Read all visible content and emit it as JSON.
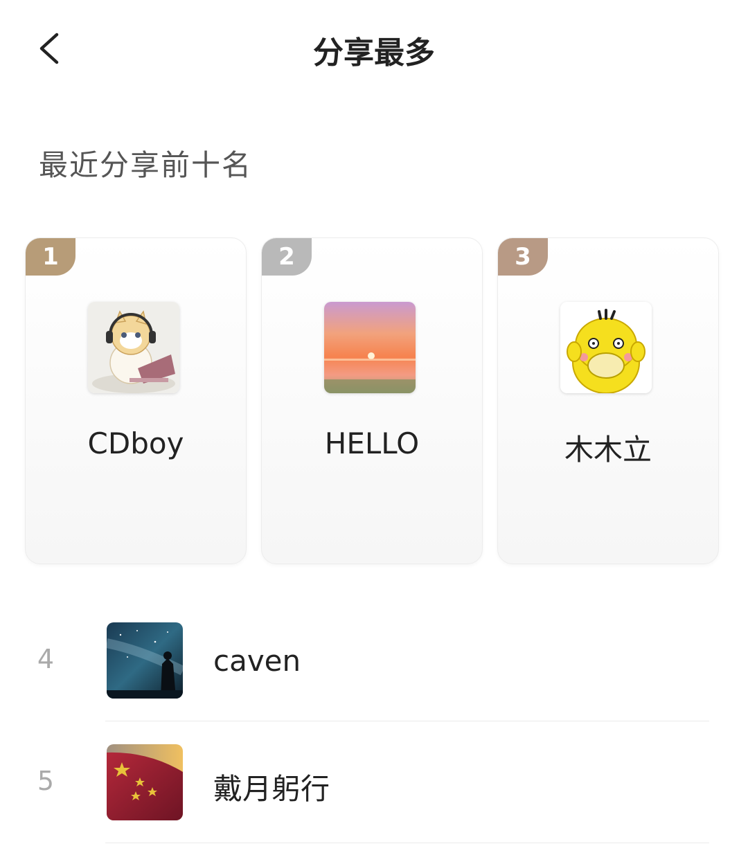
{
  "header": {
    "title": "分享最多"
  },
  "section": {
    "title": "最近分享前十名"
  },
  "podium": [
    {
      "rank": "1",
      "name": "CDboy",
      "avatar": "cat-with-headphones-laptop",
      "badge_color": "#b79c78"
    },
    {
      "rank": "2",
      "name": "HELLO",
      "avatar": "sunset-sea",
      "badge_color": "#b9b9b9"
    },
    {
      "rank": "3",
      "name": "木木立",
      "avatar": "yellow-duck",
      "badge_color": "#b89a85"
    }
  ],
  "list": [
    {
      "rank": "4",
      "name": "caven",
      "avatar": "night-sky-milky-way"
    },
    {
      "rank": "5",
      "name": "戴月躬行",
      "avatar": "red-flag-stars"
    }
  ],
  "colors": {
    "background": "#ffffff",
    "text": "#222222",
    "muted": "#aaaaaa"
  }
}
